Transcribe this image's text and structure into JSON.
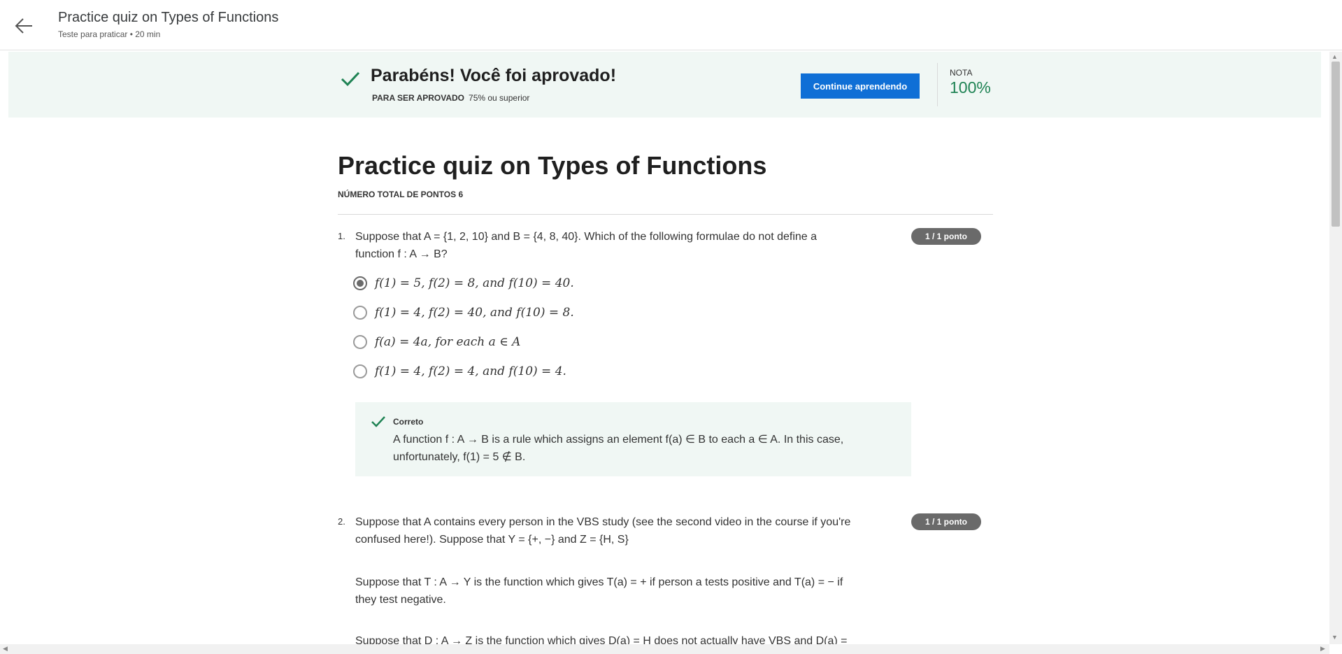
{
  "header": {
    "title": "Practice quiz on Types of Functions",
    "subtitle": "Teste para praticar • 20 min"
  },
  "banner": {
    "message": "Parabéns! Você foi aprovado!",
    "requirement_label": "PARA SER APROVADO",
    "requirement_value": "75% ou superior",
    "continue_label": "Continue aprendendo",
    "grade_label": "NOTA",
    "grade_value": "100%",
    "success_color": "#1f8354",
    "accent_color": "#0f6fd6"
  },
  "quiz": {
    "title": "Practice quiz on Types of Functions",
    "total_points": "NÚMERO TOTAL DE PONTOS 6"
  },
  "questions": [
    {
      "number": "1.",
      "text_line1": "Suppose that A = {1, 2, 10} and B = {4, 8, 40}. Which of the following formulae do not define a",
      "text_line2": "function f : A → B?",
      "points": "1 / 1 ponto",
      "options": [
        {
          "label": "f(1) = 5, f(2) = 8, and f(10) = 40.",
          "selected": true
        },
        {
          "label": "f(1) = 4, f(2) = 40, and f(10) = 8.",
          "selected": false
        },
        {
          "label": "f(a) = 4a, for each a ∈ A",
          "selected": false
        },
        {
          "label": "f(1) = 4, f(2) = 4, and f(10) = 4.",
          "selected": false
        }
      ],
      "feedback": {
        "title": "Correto",
        "line1": "A function f : A → B is a rule which assigns an element f(a) ∈ B to each a ∈ A. In this case,",
        "line2": "unfortunately, f(1) = 5 ∉ B."
      }
    },
    {
      "number": "2.",
      "text_line1": "Suppose that A contains every person in the VBS study (see the second video in the course if you're",
      "text_line2": "confused here!). Suppose that Y = {+, −} and Z = {H, S}",
      "points": "1 / 1 ponto",
      "para2_line1": "Suppose that T : A → Y is the function which gives T(a) = + if person a tests positive and T(a) = − if",
      "para2_line2": "they test negative.",
      "para3_line1": "Suppose that D : A → Z is the function which gives D(a) = H does not actually have VBS and D(a) ="
    }
  ]
}
